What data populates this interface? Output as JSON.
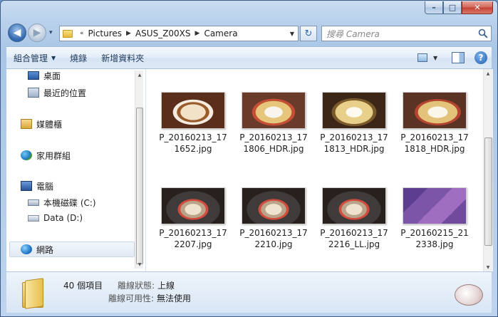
{
  "window": {
    "caption": {
      "minimize_glyph": "–",
      "maximize_glyph": "□",
      "close_glyph": "✕"
    }
  },
  "nav": {
    "back_glyph": "◀",
    "forward_glyph": "▶",
    "recent_glyph": "▾",
    "breadcrumb_prefix": "«",
    "breadcrumb": [
      "Pictures",
      "ASUS_Z00XS",
      "Camera"
    ],
    "search_placeholder": "搜尋 Camera",
    "refresh_glyph": "↻"
  },
  "toolbar": {
    "organize_label": "組合管理",
    "burn_label": "燒錄",
    "new_folder_label": "新增資料夾",
    "help_label": "?"
  },
  "sidebar": {
    "items": [
      {
        "label": "桌面",
        "icon": "desktop-icon"
      },
      {
        "label": "最近的位置",
        "icon": "recent-places-icon"
      },
      {
        "label": "媒體櫃",
        "icon": "library-icon"
      },
      {
        "label": "家用群組",
        "icon": "homegroup-icon"
      },
      {
        "label": "電腦",
        "icon": "computer-icon"
      },
      {
        "label": "本機磁碟 (C:)",
        "icon": "local-disk-icon"
      },
      {
        "label": "Data (D:)",
        "icon": "drive-icon"
      },
      {
        "label": "網路",
        "icon": "network-icon"
      }
    ]
  },
  "files": [
    {
      "name": "P_20160213_171652.jpg",
      "image": "coffee"
    },
    {
      "name": "P_20160213_171806_HDR.jpg",
      "image": "pasta"
    },
    {
      "name": "P_20160213_171813_HDR.jpg",
      "image": "pasta"
    },
    {
      "name": "P_20160213_171818_HDR.jpg",
      "image": "pasta"
    },
    {
      "name": "P_20160213_172207.jpg",
      "image": "dessert"
    },
    {
      "name": "P_20160213_172210.jpg",
      "image": "dessert"
    },
    {
      "name": "P_20160213_172216_LL.jpg",
      "image": "dessert"
    },
    {
      "name": "P_20160215_212338.jpg",
      "image": "board"
    }
  ],
  "details": {
    "item_count": "40 個項目",
    "offline_status_label": "離線狀態:",
    "offline_status_value": "上線",
    "offline_avail_label": "離線可用性:",
    "offline_avail_value": "無法使用"
  }
}
